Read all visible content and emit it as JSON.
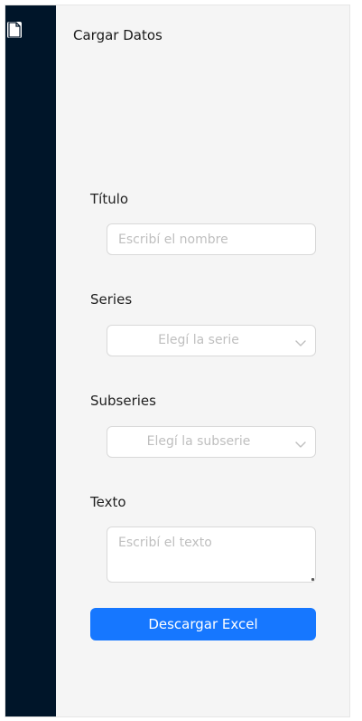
{
  "menu": {
    "item_label": "Cargar Datos",
    "item_icon": "file-icon"
  },
  "form": {
    "titulo_label": "Título",
    "titulo_placeholder": "Escribí el nombre",
    "series_label": "Series",
    "series_placeholder": "Elegí la serie",
    "subseries_label": "Subseries",
    "subseries_placeholder": "Elegí la subserie",
    "texto_label": "Texto",
    "texto_placeholder": "Escribí el texto",
    "submit_label": "Descargar Excel"
  },
  "colors": {
    "sidebar_bg": "#001529",
    "page_bg": "#f5f5f5",
    "primary": "#1677ff",
    "border": "#d9d9d9",
    "placeholder": "#bfbfbf"
  }
}
